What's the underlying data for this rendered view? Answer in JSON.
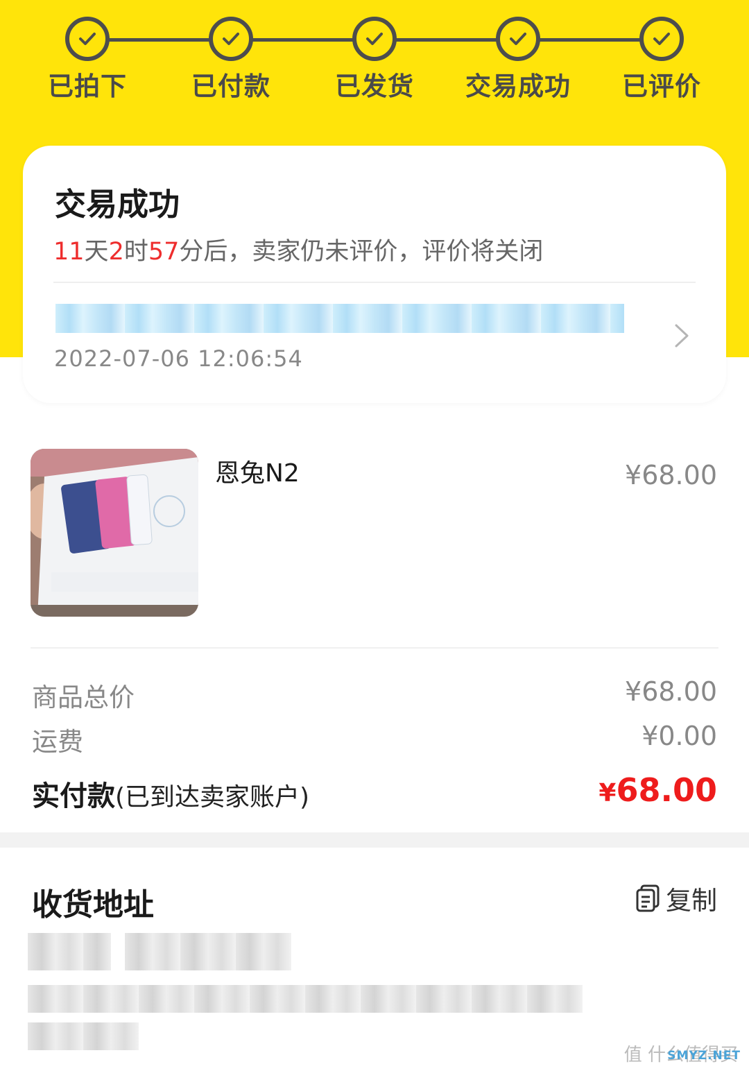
{
  "progress": {
    "steps": [
      {
        "label": "已拍下",
        "done": true
      },
      {
        "label": "已付款",
        "done": true
      },
      {
        "label": "已发货",
        "done": true
      },
      {
        "label": "交易成功",
        "done": true
      },
      {
        "label": "已评价",
        "done": true
      }
    ]
  },
  "status": {
    "title": "交易成功",
    "countdown": {
      "days": "11",
      "days_unit": "天",
      "hours": "2",
      "hours_unit": "时",
      "minutes": "57",
      "suffix": "分后，卖家仍未评价，评价将关闭"
    },
    "shipping_time": "2022-07-06 12:06:54"
  },
  "product": {
    "name": "恩兔N2",
    "price": "¥68.00",
    "image_icon": "product-photo"
  },
  "summary": {
    "goods_total_label": "商品总价",
    "goods_total_value": "¥68.00",
    "shipping_label": "运费",
    "shipping_value": "¥0.00",
    "paid_label": "实付款",
    "paid_note": "(已到达卖家账户)",
    "paid_currency": "¥",
    "paid_amount": "68.00"
  },
  "address": {
    "title": "收货地址",
    "copy_label": "复制"
  },
  "watermark": {
    "text": "值 什么值得买",
    "site": "SMYZ.NET"
  },
  "colors": {
    "brand_yellow": "#ffe40a",
    "price_red": "#ee1c1c",
    "countdown_red": "#ee2d2d"
  }
}
